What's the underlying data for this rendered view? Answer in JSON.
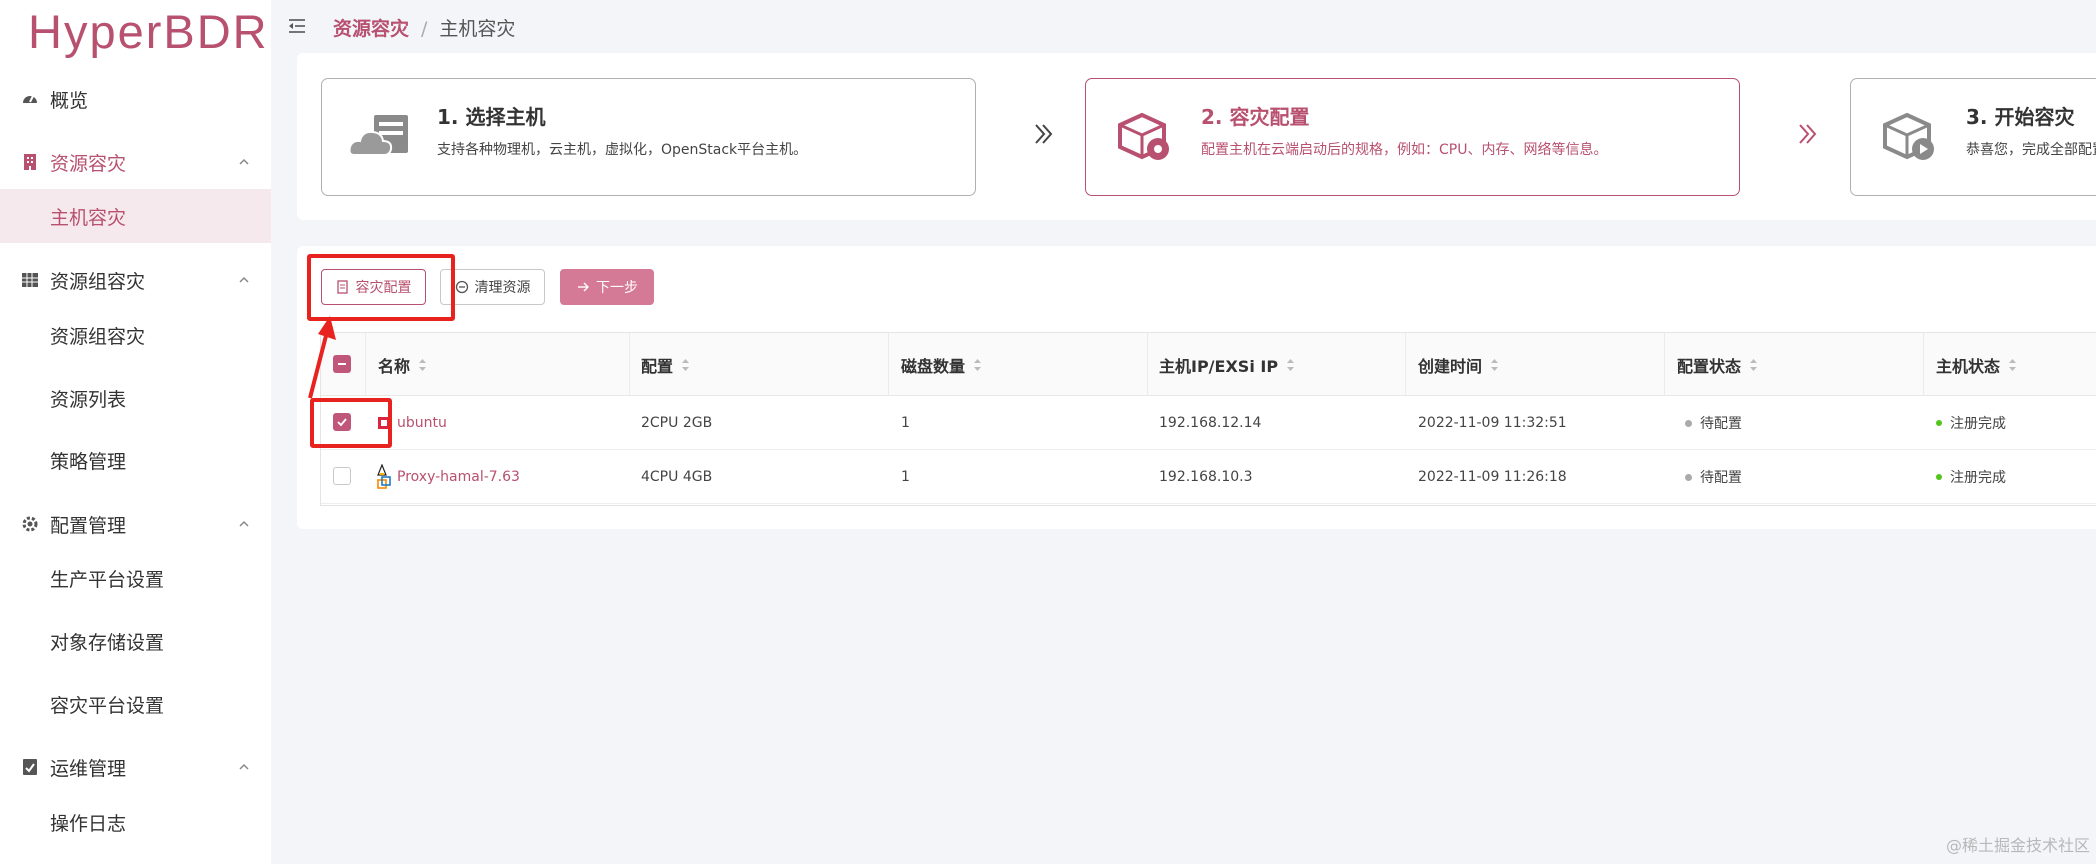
{
  "app": {
    "logo": "HyperBDR"
  },
  "sidebar": {
    "items": [
      {
        "label": "概览",
        "icon": "dashboard-icon"
      },
      {
        "label": "资源容灾",
        "icon": "building-icon"
      },
      {
        "label": "主机容灾"
      },
      {
        "label": "资源组容灾",
        "icon": "grid-icon"
      },
      {
        "label": "资源组容灾"
      },
      {
        "label": "资源列表"
      },
      {
        "label": "策略管理"
      },
      {
        "label": "配置管理",
        "icon": "settings-icon"
      },
      {
        "label": "生产平台设置"
      },
      {
        "label": "对象存储设置"
      },
      {
        "label": "容灾平台设置"
      },
      {
        "label": "运维管理",
        "icon": "ops-icon"
      },
      {
        "label": "操作日志"
      }
    ]
  },
  "breadcrumb": {
    "first": "资源容灾",
    "separator": "/",
    "second": "主机容灾"
  },
  "steps": [
    {
      "title": "1. 选择主机",
      "desc": "支持各种物理机，云主机，虚拟化，OpenStack平台主机。"
    },
    {
      "title": "2. 容灾配置",
      "desc": "配置主机在云端启动后的规格，例如：CPU、内存、网络等信息。"
    },
    {
      "title": "3. 开始容灾",
      "desc": "恭喜您，完成全部配置"
    }
  ],
  "toolbar": {
    "config_label": "容灾配置",
    "clean_label": "清理资源",
    "next_label": "下一步"
  },
  "table": {
    "headers": [
      "名称",
      "配置",
      "磁盘数量",
      "主机IP/EXSi IP",
      "创建时间",
      "配置状态",
      "主机状态"
    ],
    "rows": [
      {
        "name": "ubuntu",
        "config": "2CPU 2GB",
        "disks": "1",
        "ip": "192.168.12.14",
        "created": "2022-11-09 11:32:51",
        "config_status": "待配置",
        "host_status": "注册完成",
        "checked": true
      },
      {
        "name": "Proxy-hamal-7.63",
        "config": "4CPU 4GB",
        "disks": "1",
        "ip": "192.168.10.3",
        "created": "2022-11-09 11:26:18",
        "config_status": "待配置",
        "host_status": "注册完成",
        "checked": false
      }
    ]
  },
  "watermark": "@稀土掘金技术社区",
  "colors": {
    "accent": "#b8506f",
    "status_pending": "#aaaaaa",
    "status_ok": "#52c41a",
    "annotation": "#e8221e"
  }
}
